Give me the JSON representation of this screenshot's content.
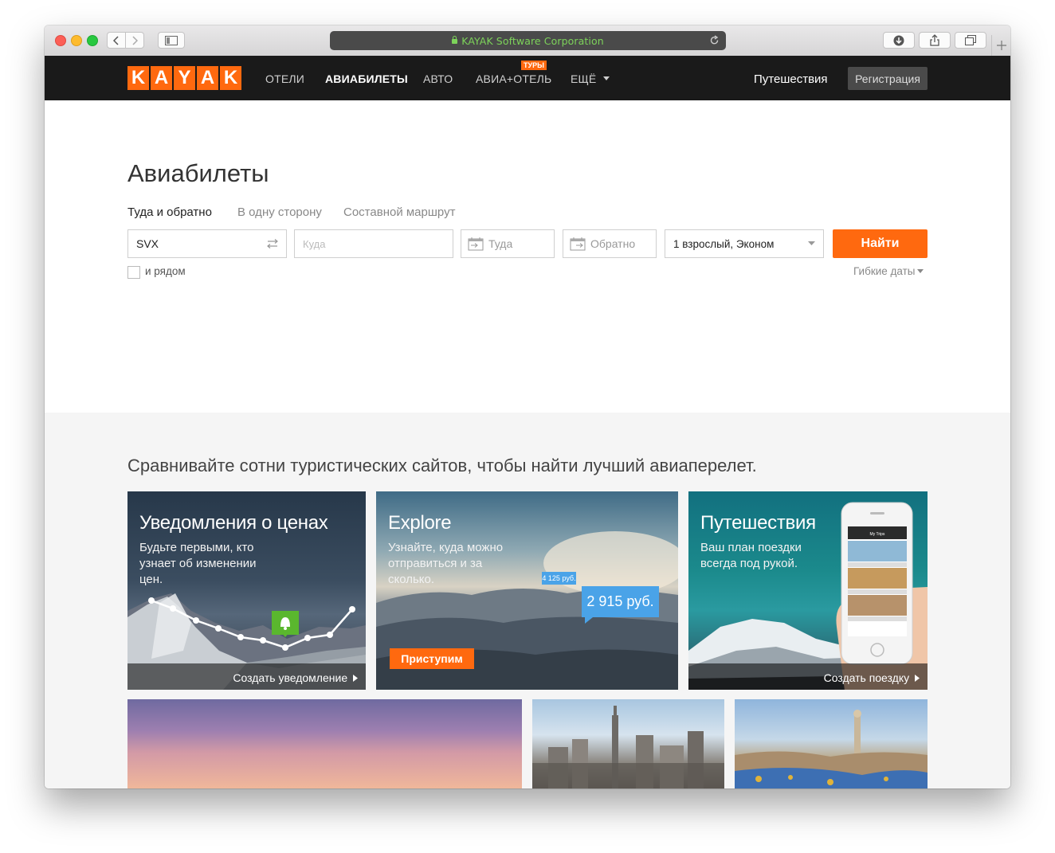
{
  "browser": {
    "url_text": "KAYAK Software Corporation"
  },
  "nav": {
    "logo_letters": [
      "K",
      "A",
      "Y",
      "A",
      "K"
    ],
    "items": [
      "ОТЕЛИ",
      "АВИАБИЛЕТЫ",
      "АВТО",
      "АВИА+ОТЕЛЬ",
      "ЕЩЁ"
    ],
    "active": "АВИАБИЛЕТЫ",
    "tours_badge": "ТУРЫ",
    "trips": "Путешествия",
    "register": "Регистрация"
  },
  "search": {
    "title": "Авиабилеты",
    "trip_types": [
      "Туда и обратно",
      "В одну сторону",
      "Составной маршрут"
    ],
    "selected_trip_type": "Туда и обратно",
    "origin_value": "SVX",
    "destination_placeholder": "Куда",
    "depart_placeholder": "Туда",
    "return_placeholder": "Обратно",
    "travelers_value": "1 взрослый, Эконом",
    "search_button": "Найти",
    "nearby_label": "и рядом",
    "nearby_checked": false,
    "flex_dates": "Гибкие даты"
  },
  "promo": {
    "tagline": "Сравнивайте сотни туристических сайтов, чтобы найти лучший авиаперелет.",
    "cards": [
      {
        "title": "Уведомления о ценах",
        "desc": "Будьте первыми, кто узнает об изменении цен.",
        "cta": "Создать уведомление"
      },
      {
        "title": "Explore",
        "desc": "Узнайте, куда можно отправиться и за сколько.",
        "cta": "Приступим",
        "price_small": "4 125 руб.",
        "price_big": "2 915 руб."
      },
      {
        "title": "Путешествия",
        "desc": "Ваш план поездки всегда под рукой.",
        "cta": "Создать поездку",
        "phone_header": "My Trips"
      }
    ]
  },
  "colors": {
    "brand_orange": "#ff690f",
    "nav_bg": "#1a1a1a"
  }
}
